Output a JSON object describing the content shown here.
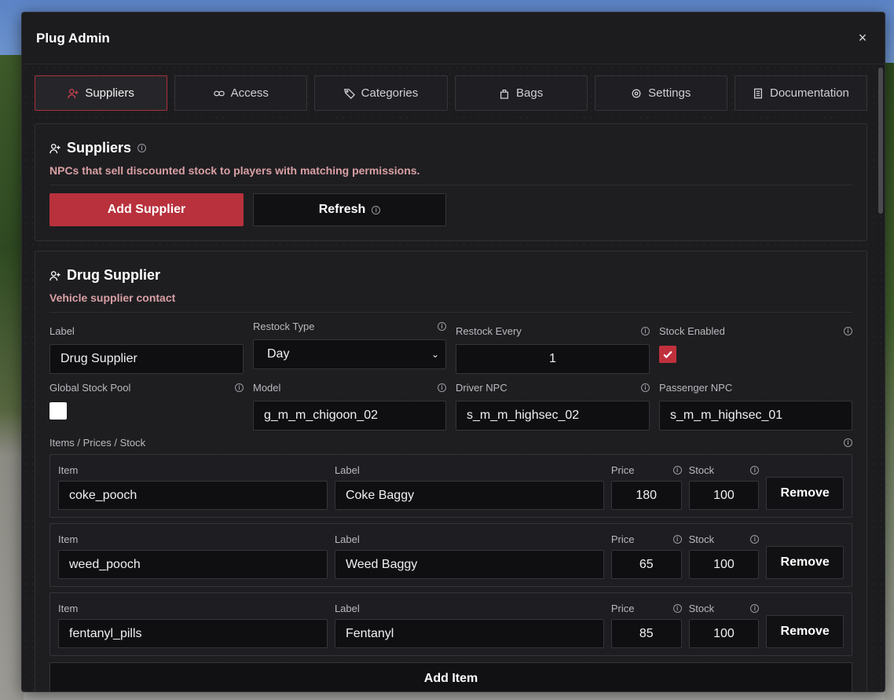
{
  "window": {
    "title": "Plug Admin",
    "close_glyph": "×"
  },
  "tabs": [
    {
      "label": "Suppliers",
      "icon": "user-plus-icon",
      "active": true
    },
    {
      "label": "Access",
      "icon": "link-icon"
    },
    {
      "label": "Categories",
      "icon": "tag-icon"
    },
    {
      "label": "Bags",
      "icon": "bag-icon"
    },
    {
      "label": "Settings",
      "icon": "settings-icon"
    },
    {
      "label": "Documentation",
      "icon": "document-icon"
    }
  ],
  "suppliers_panel": {
    "title": "Suppliers",
    "description": "NPCs that sell discounted stock to players with matching permissions.",
    "add_label": "Add Supplier",
    "refresh_label": "Refresh"
  },
  "supplier": {
    "title": "Drug Supplier",
    "subtitle": "Vehicle supplier contact",
    "fields": {
      "label": {
        "label": "Label",
        "value": "Drug Supplier"
      },
      "restock_type": {
        "label": "Restock Type",
        "value": "Day"
      },
      "restock_every": {
        "label": "Restock Every",
        "value": "1"
      },
      "stock_enabled": {
        "label": "Stock Enabled",
        "checked": true
      },
      "global_stock_pool": {
        "label": "Global Stock Pool",
        "checked": false
      },
      "model": {
        "label": "Model",
        "value": "g_m_m_chigoon_02"
      },
      "driver_npc": {
        "label": "Driver NPC",
        "value": "s_m_m_highsec_02"
      },
      "passenger_npc": {
        "label": "Passenger NPC",
        "value": "s_m_m_highsec_01"
      }
    },
    "items_heading": "Items / Prices / Stock",
    "item_col_labels": {
      "item": "Item",
      "label": "Label",
      "price": "Price",
      "stock": "Stock"
    },
    "remove_label": "Remove",
    "items": [
      {
        "item": "coke_pooch",
        "label": "Coke Baggy",
        "price": "180",
        "stock": "100"
      },
      {
        "item": "weed_pooch",
        "label": "Weed Baggy",
        "price": "65",
        "stock": "100"
      },
      {
        "item": "fentanyl_pills",
        "label": "Fentanyl",
        "price": "85",
        "stock": "100"
      }
    ],
    "add_item_label": "Add Item"
  },
  "colors": {
    "accent": "#b8313c",
    "panel": "#1c1c1f",
    "subtitle": "#d9a0a4"
  }
}
